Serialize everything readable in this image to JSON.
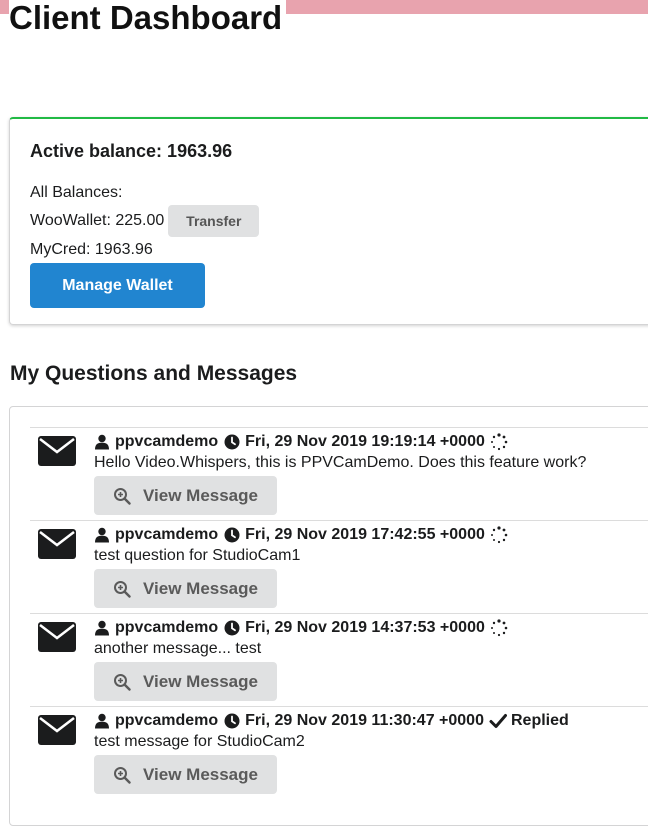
{
  "page": {
    "title": "Client Dashboard",
    "accent_color": "#e8a3ae"
  },
  "wallet": {
    "active_balance": "Active balance: 1963.96",
    "all_balances_label": "All Balances:",
    "woo_wallet": "WooWallet: 225.00",
    "transfer_label": "Transfer",
    "mycred": "MyCred: 1963.96",
    "manage_label": "Manage Wallet",
    "card_border_color": "#21ba45",
    "button_color": "#2185d0"
  },
  "messages": {
    "heading": "My Questions and Messages",
    "view_label": "View Message",
    "icons": {
      "envelope": "envelope-icon",
      "user": "user-icon",
      "clock": "clock-icon",
      "zoom": "zoom-in-icon",
      "pending": "spinner-icon",
      "replied": "check-icon"
    },
    "items": [
      {
        "author": "ppvcamdemo",
        "date": "Fri, 29 Nov 2019 19:19:14 +0000",
        "status": "",
        "text": "Hello Video.Whispers, this is PPVCamDemo. Does this feature work?"
      },
      {
        "author": "ppvcamdemo",
        "date": "Fri, 29 Nov 2019 17:42:55 +0000",
        "status": "",
        "text": "test question for StudioCam1"
      },
      {
        "author": "ppvcamdemo",
        "date": "Fri, 29 Nov 2019 14:37:53 +0000",
        "status": "",
        "text": "another message... test"
      },
      {
        "author": "ppvcamdemo",
        "date": "Fri, 29 Nov 2019 11:30:47 +0000",
        "status": "Replied",
        "text": "test message for StudioCam2"
      }
    ]
  }
}
